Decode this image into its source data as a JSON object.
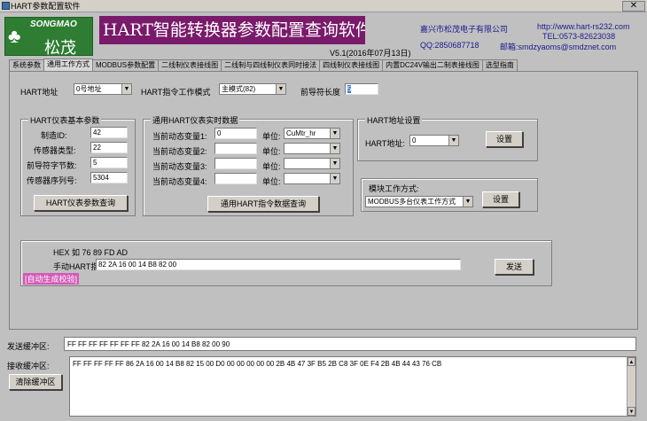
{
  "window": {
    "title": "HART参数配置软件",
    "close": "✕"
  },
  "header": {
    "logo_brand": "SONGMAO",
    "logo_cn": "松茂",
    "app_title": "HART智能转换器参数配置查询软件",
    "version": "V5.1(2016年07月13日)",
    "company": "嘉兴市松茂电子有限公司",
    "website": "http://www.hart-rs232.com",
    "tel": "TEL:0573-82623038",
    "qq": "QQ:2850687718",
    "email": "邮箱:smdzyaoms@smdznet.com"
  },
  "tabs": [
    {
      "label": "系统参数",
      "active": false
    },
    {
      "label": "通用工作方式",
      "active": true
    },
    {
      "label": "MODBUS参数配置",
      "active": false
    },
    {
      "label": "二线制仪表接线图",
      "active": false
    },
    {
      "label": "二线制与四线制仪表同时接法",
      "active": false
    },
    {
      "label": "四线制仪表接线图",
      "active": false
    },
    {
      "label": "内置DC24V输出二制表接线图",
      "active": false
    },
    {
      "label": "选型指南",
      "active": false
    }
  ],
  "top_row": {
    "hart_addr_label": "HART地址",
    "hart_addr_value": "0号地址",
    "cmd_mode_label": "HART指令工作模式",
    "cmd_mode_value": "主模式(82)",
    "preamble_label": "前导符长度",
    "preamble_value": "5"
  },
  "basic_params": {
    "title": "HART仪表基本参数",
    "fields": [
      {
        "label": "制造ID:",
        "value": "42"
      },
      {
        "label": "传感器类型:",
        "value": "22"
      },
      {
        "label": "前导符字节数:",
        "value": "5"
      },
      {
        "label": "传感器序列号:",
        "value": "5304"
      }
    ],
    "query_button": "HART仪表参数查询"
  },
  "realtime": {
    "title": "通用HART仪表实时数据",
    "unit_label": "单位:",
    "rows": [
      {
        "label": "当前动态变量1:",
        "value": "0",
        "unit": "CuMtr_hr"
      },
      {
        "label": "当前动态变量2:",
        "value": "",
        "unit": ""
      },
      {
        "label": "当前动态变量3:",
        "value": "",
        "unit": ""
      },
      {
        "label": "当前动态变量4:",
        "value": "",
        "unit": ""
      }
    ],
    "query_button": "通用HART指令数据查询"
  },
  "hart_addr_settings": {
    "title": "HART地址设置",
    "label": "HART地址:",
    "value": "0",
    "button": "设置"
  },
  "module_mode": {
    "title": "模块工作方式:",
    "value": "MODBUS多台仪表工作方式",
    "button": "设置"
  },
  "manual_cmd": {
    "hex_hint": "HEX 如 76 89 FD AD",
    "label": "手动HART指令",
    "value": "82 2A 16 00 14 B8 82 00",
    "auto_checksum": "[自动生成校验]",
    "send_button": "发送"
  },
  "send_buffer": {
    "label": "发送缓冲区:",
    "value": "FF FF FF FF FF FF FF 82 2A 16 00 14 B8 82 00 90"
  },
  "recv_buffer": {
    "label": "接收缓冲区:",
    "value": "FF FF FF FF FF 86 2A 16 00 14 B8 82 15 00 D0 00 00 00 00 00 2B 4B 47 3F B5 2B C8 3F 0E F4 2B 4B 44 43 76 CB",
    "clear_button": "清除缓冲区"
  }
}
